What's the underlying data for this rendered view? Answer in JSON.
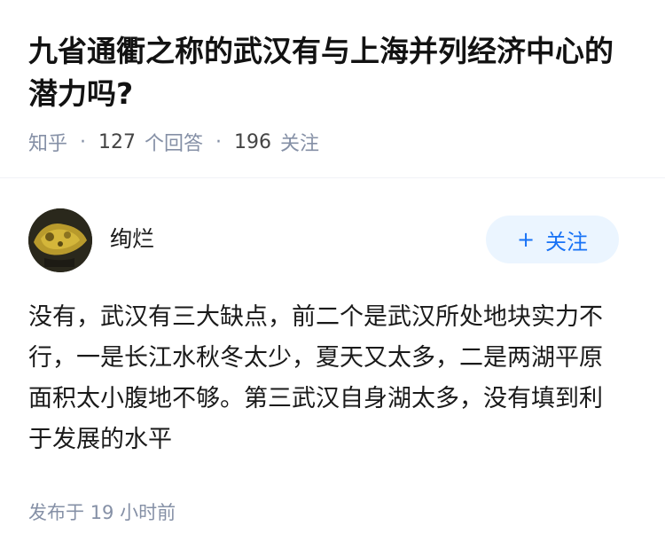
{
  "question": {
    "title": "九省通衢之称的武汉有与上海并列经济中心的潜力吗?",
    "source": "知乎",
    "answer_count": "127",
    "answer_label": "个回答",
    "follow_count": "196",
    "follow_label": "关注"
  },
  "answer": {
    "author_name": "绚烂",
    "follow_button_label": "关注",
    "follow_icon": "plus-icon",
    "content": "没有，武汉有三大缺点，前二个是武汉所处地块实力不行，一是长江水秋冬太少，夏天又太多，二是两湖平原面积太小腹地不够。第三武汉自身湖太多，没有填到利于发展的水平",
    "published_label": "发布于",
    "published_value": "19",
    "published_unit": "小时前"
  },
  "colors": {
    "meta_gray": "#8590a6",
    "follow_bg": "#ebf5ff",
    "follow_text": "#1772f6"
  }
}
